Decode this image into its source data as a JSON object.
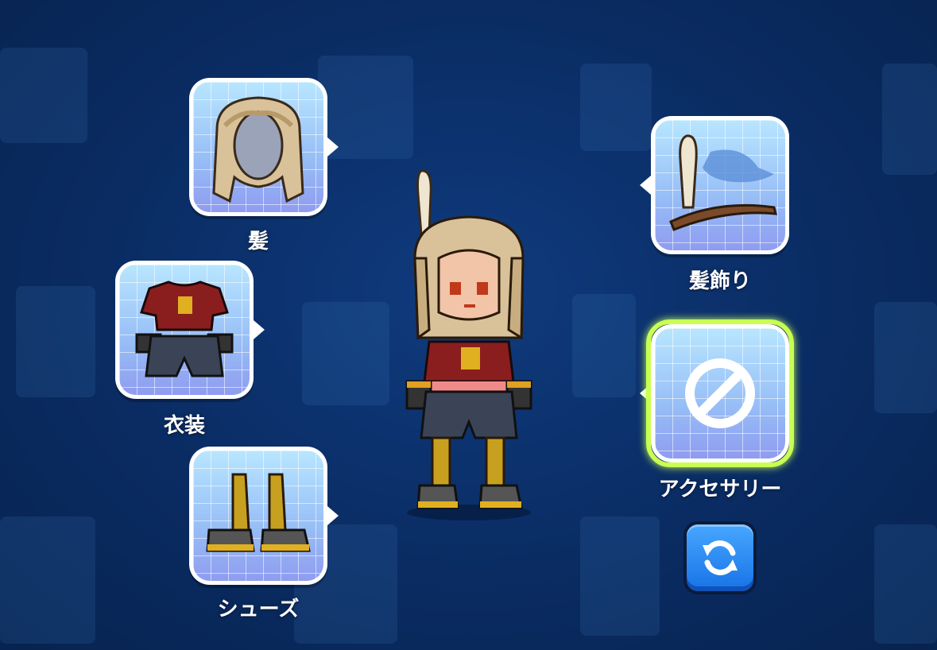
{
  "slots": {
    "hair": {
      "label": "髪",
      "icon": "hair-icon"
    },
    "costume": {
      "label": "衣装",
      "icon": "costume-icon"
    },
    "shoes": {
      "label": "シューズ",
      "icon": "shoes-icon"
    },
    "hair_accessory": {
      "label": "髪飾り",
      "icon": "feather-hat-icon"
    },
    "accessory": {
      "label": "アクセサリー",
      "icon": "none-icon",
      "selected": true
    }
  },
  "buttons": {
    "refresh_icon": "refresh-icon"
  },
  "colors": {
    "background": "#0a2c63",
    "slot_fill": "#97bdf6",
    "selected_highlight": "#c8ff52",
    "refresh_button": "#1872e6"
  }
}
